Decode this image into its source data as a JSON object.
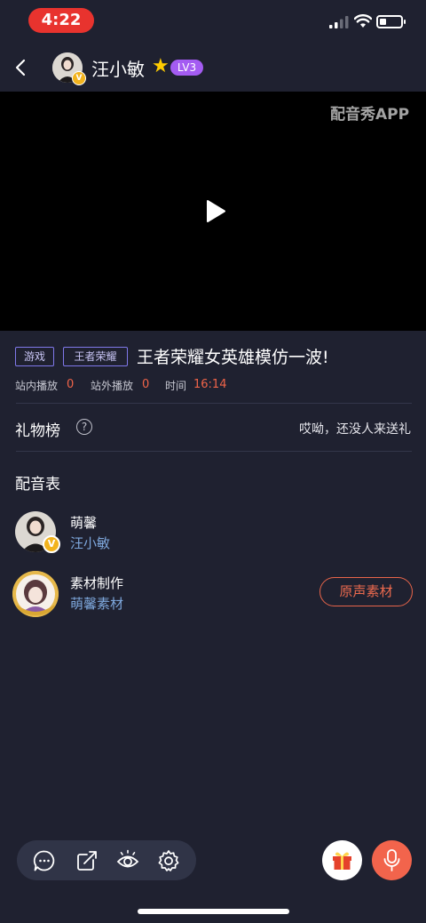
{
  "status_bar": {
    "time": "4:22"
  },
  "header": {
    "username": "汪小敏",
    "level": "LV3"
  },
  "video": {
    "watermark": "配音秀APP"
  },
  "info": {
    "tags": [
      "游戏",
      "王者荣耀"
    ],
    "title": "王者荣耀女英雄模仿一波!",
    "stats": [
      {
        "label": "站内播放",
        "value": "0"
      },
      {
        "label": "站外播放",
        "value": "0"
      },
      {
        "label": "时间",
        "value": "16:14"
      }
    ]
  },
  "gift": {
    "label": "礼物榜",
    "help": "?",
    "empty_text": "哎呦，还没人来送礼"
  },
  "dubbing": {
    "title": "配音表",
    "rows": [
      {
        "role": "萌馨",
        "user": "汪小敏"
      },
      {
        "role": "素材制作",
        "user": "萌馨素材",
        "button": "原声素材"
      }
    ]
  },
  "badge": "V",
  "colors": {
    "accent": "#f2644c",
    "background": "#1f2130",
    "tag_border": "#7f78ea",
    "link": "#7ea8dd"
  },
  "icons": [
    "back-arrow-icon",
    "play-icon",
    "comment-icon",
    "share-icon",
    "eye-icon",
    "settings-icon",
    "gift-icon",
    "mic-icon"
  ]
}
